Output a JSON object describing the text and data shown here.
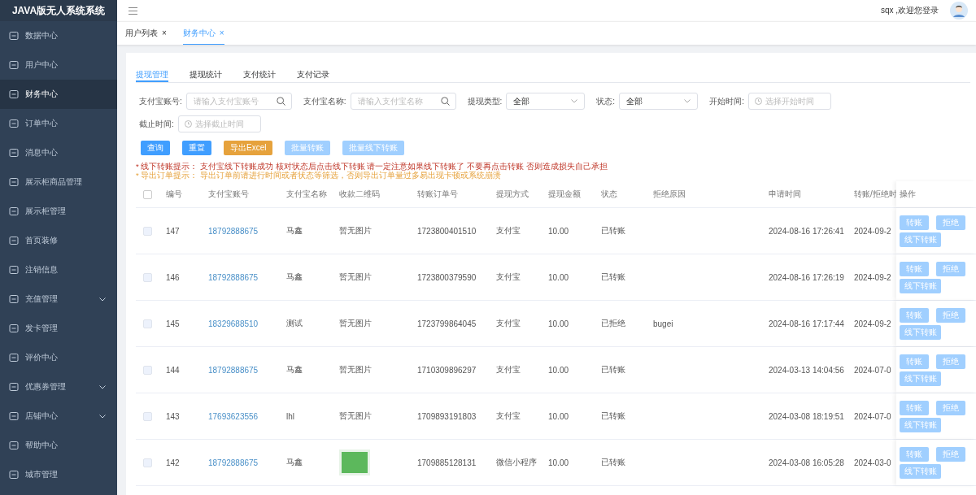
{
  "app_title": "JAVA版无人系统系统",
  "sidebar": {
    "items": [
      {
        "label": "数据中心",
        "selected": false,
        "expandable": false
      },
      {
        "label": "用户中心",
        "selected": false,
        "expandable": false
      },
      {
        "label": "财务中心",
        "selected": true,
        "expandable": false
      },
      {
        "label": "订单中心",
        "selected": false,
        "expandable": false
      },
      {
        "label": "消息中心",
        "selected": false,
        "expandable": false
      },
      {
        "label": "展示柜商品管理",
        "selected": false,
        "expandable": false
      },
      {
        "label": "展示柜管理",
        "selected": false,
        "expandable": false
      },
      {
        "label": "首页装修",
        "selected": false,
        "expandable": false
      },
      {
        "label": "注销信息",
        "selected": false,
        "expandable": false
      },
      {
        "label": "充值管理",
        "selected": false,
        "expandable": true
      },
      {
        "label": "发卡管理",
        "selected": false,
        "expandable": false
      },
      {
        "label": "评价中心",
        "selected": false,
        "expandable": false
      },
      {
        "label": "优惠券管理",
        "selected": false,
        "expandable": true
      },
      {
        "label": "店铺中心",
        "selected": false,
        "expandable": true
      },
      {
        "label": "帮助中心",
        "selected": false,
        "expandable": false
      },
      {
        "label": "城市管理",
        "selected": false,
        "expandable": false
      }
    ]
  },
  "header": {
    "welcome": "sqx ,欢迎您登录"
  },
  "page_tabs": [
    {
      "label": "用户列表",
      "close": "×",
      "selected": false
    },
    {
      "label": "财务中心",
      "close": "×",
      "selected": true
    }
  ],
  "tabs": [
    {
      "label": "提现管理",
      "selected": true
    },
    {
      "label": "提现统计",
      "selected": false
    },
    {
      "label": "支付统计",
      "selected": false
    },
    {
      "label": "支付记录",
      "selected": false
    }
  ],
  "filters": [
    {
      "kind": "search",
      "label": "支付宝账号:",
      "placeholder": "请输入支付宝账号"
    },
    {
      "kind": "search",
      "label": "支付宝名称:",
      "placeholder": "请输入支付宝名称"
    },
    {
      "kind": "select",
      "label": "提现类型:",
      "value": "全部"
    },
    {
      "kind": "select",
      "label": "状态:",
      "value": "全部"
    },
    {
      "kind": "date",
      "label": "开始时间:",
      "placeholder": "选择开始时间"
    },
    {
      "kind": "date",
      "label": "截止时间:",
      "placeholder": "选择截止时间"
    }
  ],
  "buttons": [
    {
      "label": "查询",
      "kind": "primary",
      "disabled": false
    },
    {
      "label": "重置",
      "kind": "primary",
      "disabled": false
    },
    {
      "label": "导出Excel",
      "kind": "warning",
      "disabled": false
    },
    {
      "label": "批量转账",
      "kind": "primary",
      "disabled": true
    },
    {
      "label": "批量线下转账",
      "kind": "primary",
      "disabled": true
    }
  ],
  "notices": [
    {
      "kind": "danger",
      "text": "* 线下转账提示：  支付宝线下转账成功 核对状态后点击线下转账 请一定注意如果线下转账了 不要再点击转账 否则造成损失自己承担"
    },
    {
      "kind": "warning",
      "text": "* 导出订单提示：  导出订单前请进行时间或者状态等筛选，否则导出订单量过多易出现卡顿或系统崩溃"
    }
  ],
  "table": {
    "select_all_checked": false,
    "columns": [
      "编号",
      "支付宝账号",
      "支付宝名称",
      "收款二维码",
      "转账订单号",
      "提现方式",
      "提现金额",
      "状态",
      "拒绝原因",
      "申请时间",
      "转账/拒绝时",
      "操作"
    ],
    "rows": [
      {
        "checked": false,
        "id": "147",
        "account": "18792888675",
        "name": "马鑫",
        "qr": {
          "kind": "text",
          "text": "暂无图片"
        },
        "order": "1723800401510",
        "method": "支付宝",
        "amount": "10.00",
        "status": "已转账",
        "reason": "",
        "applied": "2024-08-16 17:26:41",
        "transferred": "2024-09-2",
        "actions_disabled": true,
        "actions": [
          "转账",
          "拒绝",
          "线下转账"
        ]
      },
      {
        "checked": false,
        "id": "146",
        "account": "18792888675",
        "name": "马鑫",
        "qr": {
          "kind": "text",
          "text": "暂无图片"
        },
        "order": "1723800379590",
        "method": "支付宝",
        "amount": "10.00",
        "status": "已转账",
        "reason": "",
        "applied": "2024-08-16 17:26:19",
        "transferred": "2024-09-2",
        "actions_disabled": true,
        "actions": [
          "转账",
          "拒绝",
          "线下转账"
        ]
      },
      {
        "checked": false,
        "id": "145",
        "account": "18329688510",
        "name": "测试",
        "qr": {
          "kind": "text",
          "text": "暂无图片"
        },
        "order": "1723799864045",
        "method": "支付宝",
        "amount": "10.00",
        "status": "已拒绝",
        "reason": "bugei",
        "applied": "2024-08-16 17:17:44",
        "transferred": "2024-09-2",
        "actions_disabled": true,
        "actions": [
          "转账",
          "拒绝",
          "线下转账"
        ]
      },
      {
        "checked": false,
        "id": "144",
        "account": "18792888675",
        "name": "马鑫",
        "qr": {
          "kind": "text",
          "text": "暂无图片"
        },
        "order": "1710309896297",
        "method": "支付宝",
        "amount": "10.00",
        "status": "已转账",
        "reason": "",
        "applied": "2024-03-13 14:04:56",
        "transferred": "2024-07-0",
        "actions_disabled": true,
        "actions": [
          "转账",
          "拒绝",
          "线下转账"
        ]
      },
      {
        "checked": false,
        "id": "143",
        "account": "17693623556",
        "name": "lhl",
        "qr": {
          "kind": "text",
          "text": "暂无图片"
        },
        "order": "1709893191803",
        "method": "支付宝",
        "amount": "10.00",
        "status": "已转账",
        "reason": "",
        "applied": "2024-03-08 18:19:51",
        "transferred": "2024-07-0",
        "actions_disabled": true,
        "actions": [
          "转账",
          "拒绝",
          "线下转账"
        ]
      },
      {
        "checked": false,
        "id": "142",
        "account": "18792888675",
        "name": "马鑫",
        "qr": {
          "kind": "image"
        },
        "order": "1709885128131",
        "method": "微信小程序",
        "amount": "10.00",
        "status": "已转账",
        "reason": "",
        "applied": "2024-03-08 16:05:28",
        "transferred": "2024-03-0",
        "actions_disabled": true,
        "actions": [
          "转账",
          "拒绝",
          "线下转账"
        ]
      }
    ]
  }
}
